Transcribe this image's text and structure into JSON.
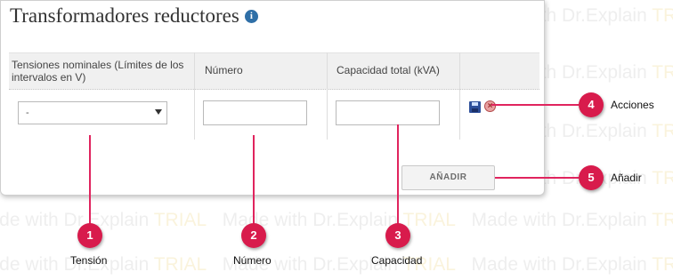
{
  "panel": {
    "title": "Transformadores reductores",
    "info_icon": "i"
  },
  "table": {
    "headers": [
      "Tensiones nominales (Límites de los intervalos en V)",
      "Número",
      "Capacidad total (kVA)"
    ],
    "row": {
      "tension_value": "-",
      "numero_value": "",
      "capacidad_value": ""
    }
  },
  "add_button_label": "AÑADIR",
  "callouts": [
    {
      "number": "1",
      "label": "Tensión"
    },
    {
      "number": "2",
      "label": "Número"
    },
    {
      "number": "3",
      "label": "Capacidad"
    },
    {
      "number": "4",
      "label": "Acciones"
    },
    {
      "number": "5",
      "label": "Añadir"
    }
  ],
  "watermark": {
    "main": "Made with Dr.Explain ",
    "trial": "TRIAL"
  },
  "colors": {
    "callout": "#d81b4c",
    "info": "#2f6fa7",
    "save": "#2d4f9a"
  }
}
